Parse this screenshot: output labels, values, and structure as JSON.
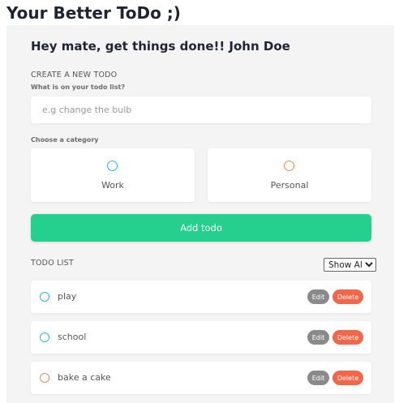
{
  "app": {
    "title": "Your Better ToDo ;)"
  },
  "greeting": "Hey mate, get things done!! John Doe",
  "create": {
    "section_title": "CREATE A NEW TODO",
    "question_label": "What is on your todo list?",
    "input_placeholder": "e.g change the bulb",
    "input_value": "",
    "category_label": "Choose a category",
    "categories": [
      {
        "label": "Work",
        "color": "#2bb5e8"
      },
      {
        "label": "Personal",
        "color": "#ef8a55"
      }
    ],
    "add_button_label": "Add todo"
  },
  "list": {
    "section_title": "TODO LIST",
    "filter": {
      "selected": "Show All"
    },
    "edit_label": "Edit",
    "delete_label": "Delete",
    "items": [
      {
        "text": "play",
        "category_color": "#2bb5e8"
      },
      {
        "text": "school",
        "category_color": "#2bb5e8"
      },
      {
        "text": "bake a cake",
        "category_color": "#ef8a55"
      }
    ]
  },
  "colors": {
    "accent": "#25cf8e",
    "edit": "#8a8a8a",
    "delete": "#f4664a"
  }
}
